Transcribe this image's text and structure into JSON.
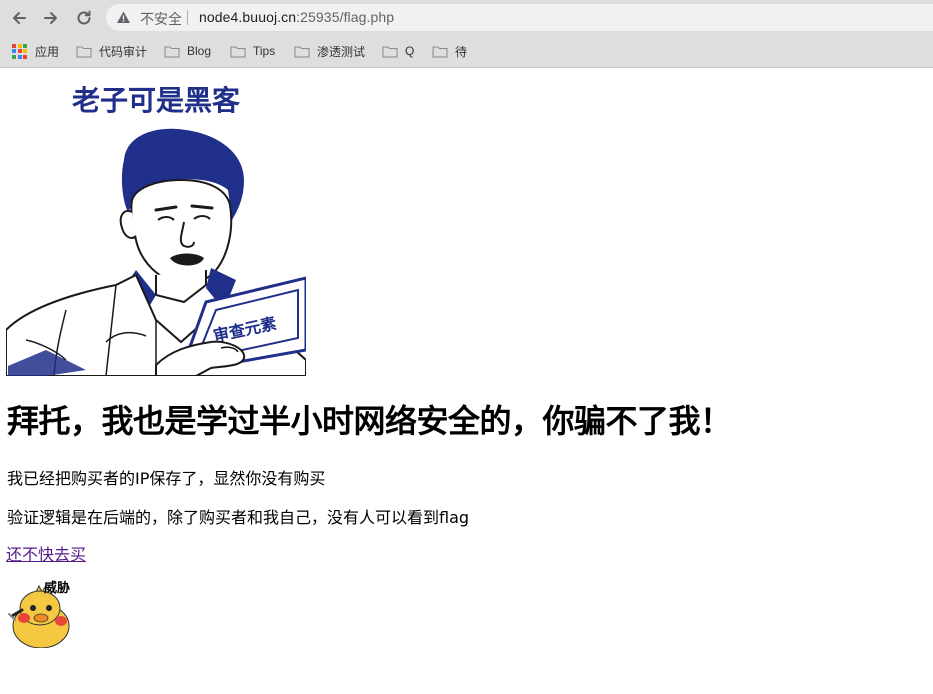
{
  "browser": {
    "security_label": "不安全",
    "url_host": "node4.buuoj.cn",
    "url_path": ":25935/flag.php"
  },
  "bookmarks": [
    {
      "label": "应用",
      "icon": "apps-grid-icon"
    },
    {
      "label": "代码审计",
      "icon": "folder-icon"
    },
    {
      "label": "Blog",
      "icon": "folder-icon"
    },
    {
      "label": "Tips",
      "icon": "folder-icon"
    },
    {
      "label": "渗透测试",
      "icon": "folder-icon"
    },
    {
      "label": "Q",
      "icon": "folder-icon"
    },
    {
      "label": "待",
      "icon": "folder-icon"
    }
  ],
  "page": {
    "meme_caption": "老子可是黑客",
    "meme_book_text": "审查元素",
    "heading": "拜托，我也是学过半小时网络安全的，你骗不了我！",
    "paragraph1": "我已经把购买者的IP保存了，显然你没有购买",
    "paragraph2": "验证逻辑是在后端的，除了购买者和我自己，没有人可以看到flag",
    "buy_link": "还不快去买",
    "sticker_caption": "威胁"
  },
  "colors": {
    "meme_blue": "#1f2f8a",
    "link_visited": "#551a8b",
    "sticker_yellow": "#f5c842"
  }
}
